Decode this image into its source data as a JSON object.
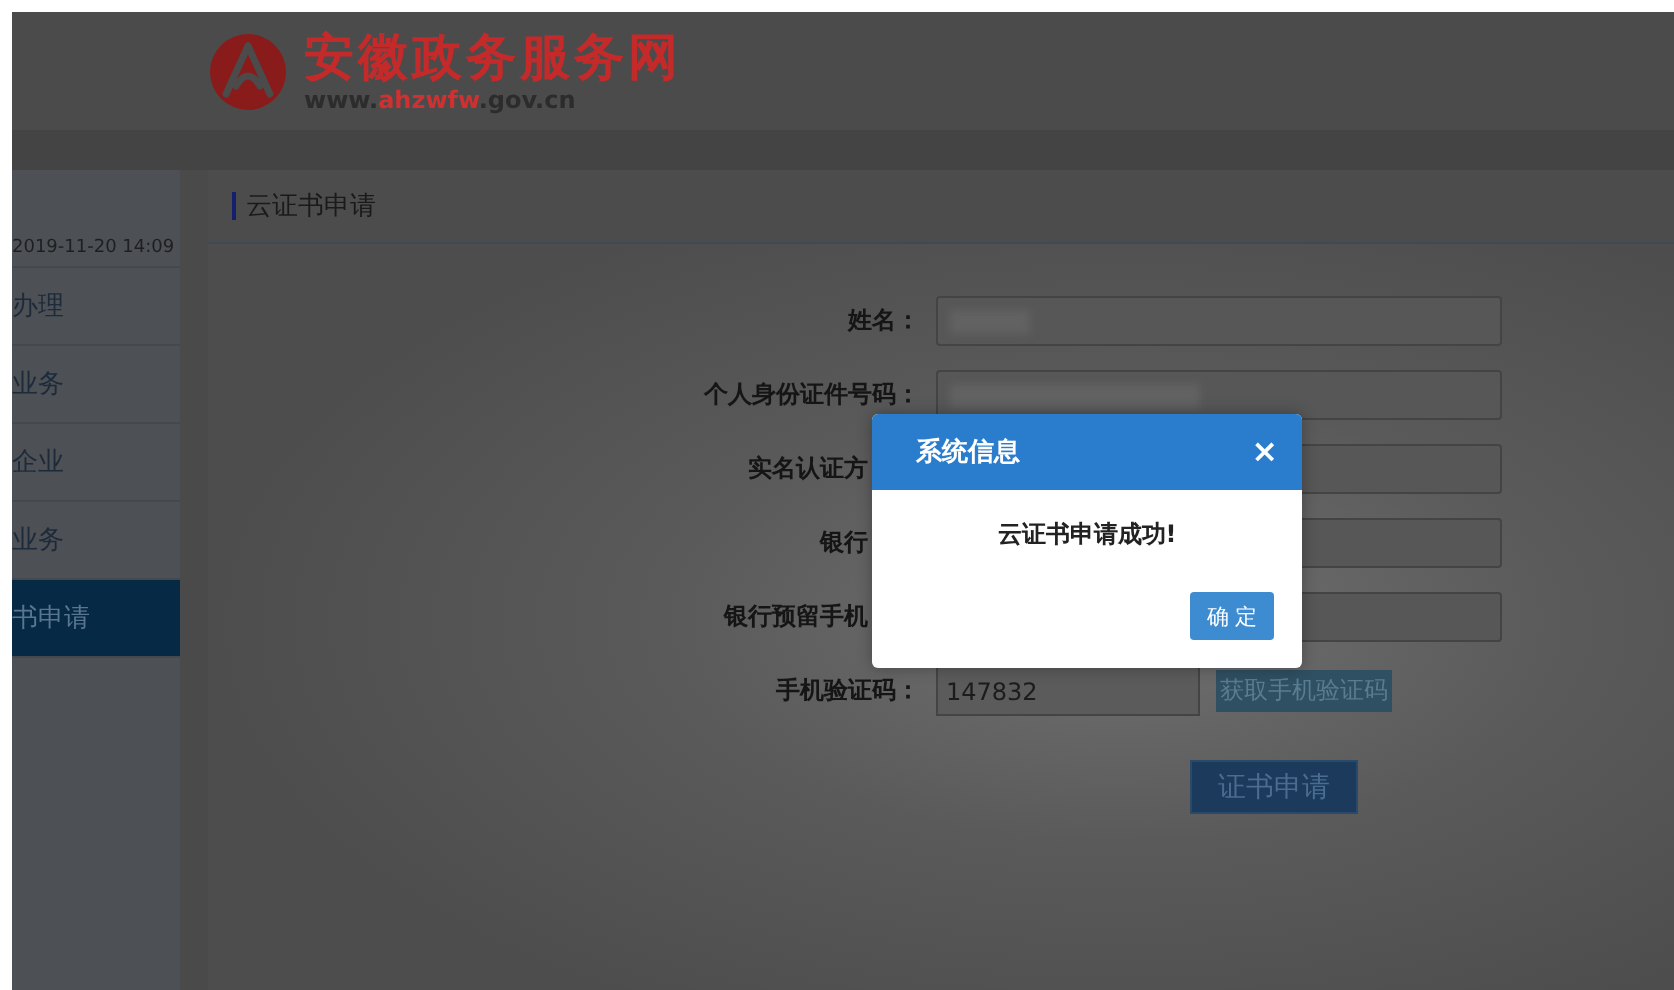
{
  "header": {
    "site_name": "安徽政务服务网",
    "url_prefix": "www.",
    "url_domain": "ahzwfw",
    "url_suffix": ".gov.cn"
  },
  "sidebar": {
    "timestamp": "2019-11-20 14:09",
    "items": [
      {
        "label": "办理",
        "selected": false
      },
      {
        "label": "业务",
        "selected": false
      },
      {
        "label": "企业",
        "selected": false
      },
      {
        "label": "业务",
        "selected": false
      },
      {
        "label": "书申请",
        "selected": true
      }
    ]
  },
  "page_title": "云证书申请",
  "form": {
    "fields": [
      {
        "kind": "redacted",
        "label": "姓名："
      },
      {
        "kind": "redacted",
        "label": "个人身份证件号码："
      },
      {
        "kind": "covered",
        "label": "实名认证方"
      },
      {
        "kind": "covered",
        "label": "银行"
      },
      {
        "kind": "covered",
        "label": "银行预留手机"
      },
      {
        "kind": "code",
        "label": "手机验证码：",
        "value": "147832",
        "button": "获取手机验证码"
      }
    ],
    "submit": "证书申请"
  },
  "dialog": {
    "title": "系统信息",
    "close": "×",
    "message": "云证书申请成功!",
    "ok": "确 定"
  }
}
